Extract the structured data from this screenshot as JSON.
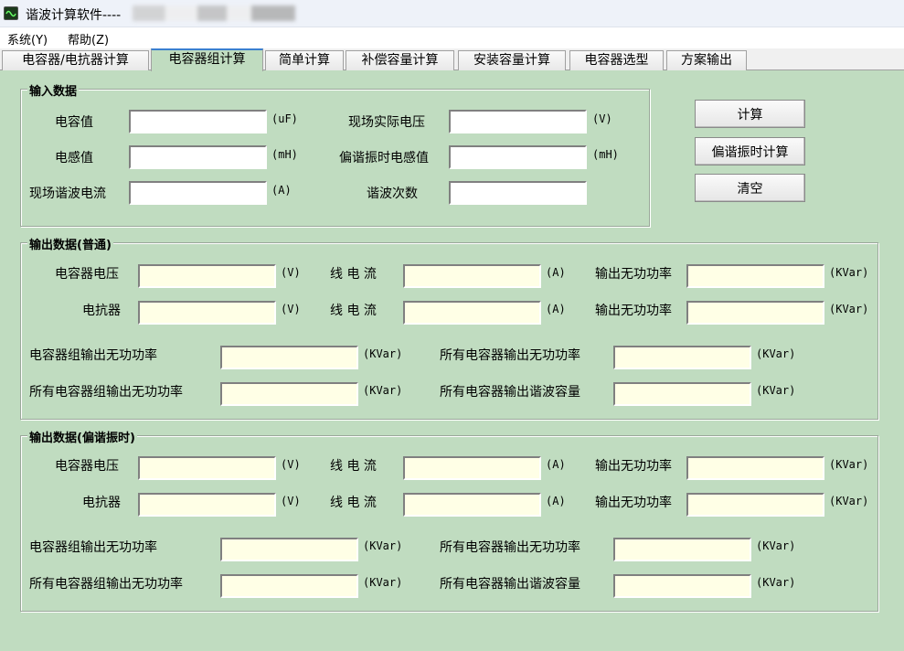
{
  "window": {
    "title": "谐波计算软件----"
  },
  "menu": [
    {
      "label": "系统(Y)"
    },
    {
      "label": "帮助(Z)"
    }
  ],
  "tabs": [
    {
      "label": "电容器/电抗器计算",
      "selected": false
    },
    {
      "label": "电容器组计算",
      "selected": true
    },
    {
      "label": "简单计算",
      "selected": false
    },
    {
      "label": "补偿容量计算",
      "selected": false
    },
    {
      "label": "安装容量计算",
      "selected": false
    },
    {
      "label": "电容器选型",
      "selected": false
    },
    {
      "label": "方案输出",
      "selected": false
    }
  ],
  "input_group": {
    "legend": "输入数据",
    "fields": [
      {
        "label": "电容值",
        "unit": "(uF)",
        "value": ""
      },
      {
        "label": "现场实际电压",
        "unit": "(V)",
        "value": ""
      },
      {
        "label": "电感值",
        "unit": "(mH)",
        "value": ""
      },
      {
        "label": "偏谐振时电感值",
        "unit": "(mH)",
        "value": ""
      },
      {
        "label": "现场谐波电流",
        "unit": "(A)",
        "value": ""
      },
      {
        "label": "谐波次数",
        "unit": "",
        "value": ""
      }
    ]
  },
  "buttons": {
    "calc": "计算",
    "calc_offres": "偏谐振时计算",
    "clear": "清空"
  },
  "output_groups": [
    {
      "legend": "输出数据(普通)",
      "fields": [
        {
          "label": "电容器电压",
          "unit": "(V)",
          "value": ""
        },
        {
          "label": "线 电 流",
          "unit": "(A)",
          "value": ""
        },
        {
          "label": "输出无功功率",
          "unit": "(KVar)",
          "value": ""
        },
        {
          "label": "电抗器",
          "unit": "(V)",
          "value": ""
        },
        {
          "label": "线 电 流",
          "unit": "(A)",
          "value": ""
        },
        {
          "label": "输出无功功率",
          "unit": "(KVar)",
          "value": ""
        },
        {
          "label": "电容器组输出无功功率",
          "unit": "(KVar)",
          "value": ""
        },
        {
          "label": "所有电容器输出无功功率",
          "unit": "(KVar)",
          "value": ""
        },
        {
          "label": "所有电容器组输出无功功率",
          "unit": "(KVar)",
          "value": ""
        },
        {
          "label": "所有电容器输出谐波容量",
          "unit": "(KVar)",
          "value": ""
        }
      ]
    },
    {
      "legend": "输出数据(偏谐振时)",
      "fields": [
        {
          "label": "电容器电压",
          "unit": "(V)",
          "value": ""
        },
        {
          "label": "线 电 流",
          "unit": "(A)",
          "value": ""
        },
        {
          "label": "输出无功功率",
          "unit": "(KVar)",
          "value": ""
        },
        {
          "label": "电抗器",
          "unit": "(V)",
          "value": ""
        },
        {
          "label": "线 电 流",
          "unit": "(A)",
          "value": ""
        },
        {
          "label": "输出无功功率",
          "unit": "(KVar)",
          "value": ""
        },
        {
          "label": "电容器组输出无功功率",
          "unit": "(KVar)",
          "value": ""
        },
        {
          "label": "所有电容器输出无功功率",
          "unit": "(KVar)",
          "value": ""
        },
        {
          "label": "所有电容器组输出无功功率",
          "unit": "(KVar)",
          "value": ""
        },
        {
          "label": "所有电容器输出谐波容量",
          "unit": "(KVar)",
          "value": ""
        }
      ]
    }
  ]
}
